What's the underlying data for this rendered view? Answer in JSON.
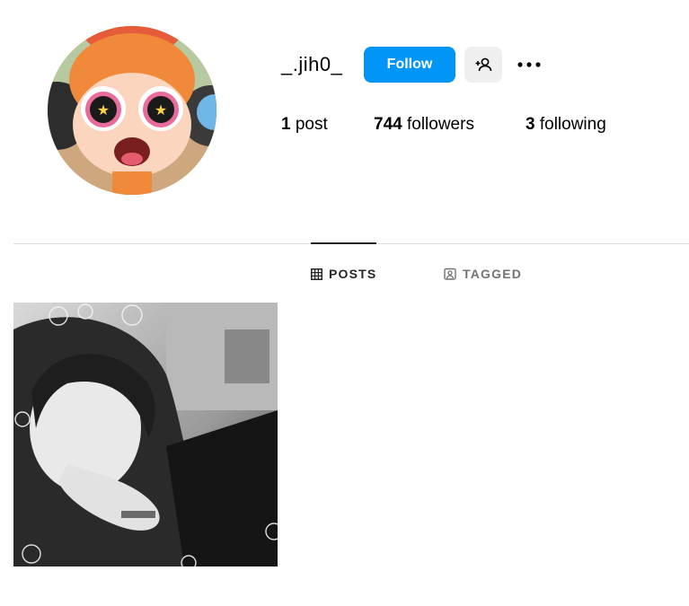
{
  "profile": {
    "username": "_.jih0_",
    "follow_label": "Follow",
    "avatar_description": "cartoon-avatar",
    "suggest_icon": "add-person-icon",
    "more_icon": "more-horizontal-icon"
  },
  "stats": {
    "posts_count": "1",
    "posts_label": "post",
    "followers_count": "744",
    "followers_label": "followers",
    "following_count": "3",
    "following_label": "following"
  },
  "tabs": [
    {
      "label": "POSTS",
      "icon": "grid-icon",
      "active": true
    },
    {
      "label": "TAGGED",
      "icon": "tag-person-icon",
      "active": false
    }
  ],
  "colors": {
    "follow_button": "#0095f6",
    "secondary_button": "#efefef",
    "divider": "#dbdbdb",
    "inactive_tab": "#737373"
  }
}
